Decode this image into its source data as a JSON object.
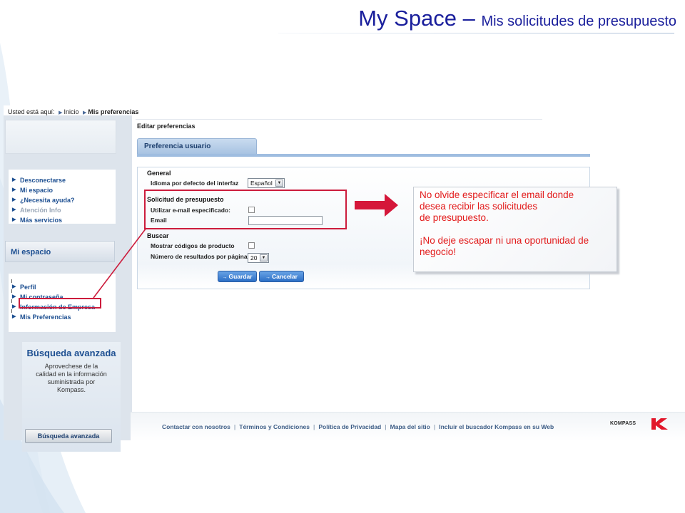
{
  "slide": {
    "title_main": "My Space",
    "title_dash": " – ",
    "title_sub": "Mis solicitudes de presupuesto"
  },
  "breadcrumb": {
    "prefix": "Usted está aquí:",
    "items": [
      "Inicio",
      "Mis preferencias"
    ]
  },
  "sidebar": {
    "links": [
      {
        "label": "Desconectarse"
      },
      {
        "label": "Mi espacio"
      },
      {
        "label": "¿Necesita ayuda?"
      },
      {
        "label": "Atención Info"
      },
      {
        "label": "Más servicios"
      }
    ],
    "section_title": "Mi espacio",
    "myspace_links": [
      {
        "label": "Perfil"
      },
      {
        "label": "Mi contraseña"
      },
      {
        "label": "Información de Empresa"
      },
      {
        "label": "Mis Preferencias"
      }
    ],
    "advanced": {
      "title": "Búsqueda avanzada",
      "text_lines": [
        "Aprovechese de la",
        "calidad en la información",
        "suministrada por",
        "Kompass."
      ],
      "button": "Búsqueda avanzada"
    }
  },
  "content": {
    "title": "Editar preferencias",
    "tab": "Preferencia usuario",
    "general": {
      "title": "General",
      "language_label": "Idioma por defecto del interfaz",
      "language_value": "Español"
    },
    "quote": {
      "title": "Solicitud de presupuesto",
      "use_email_label": "Utilizar e-mail especificado:",
      "use_email_checked": false,
      "email_label": "Email",
      "email_value": ""
    },
    "search": {
      "title": "Buscar",
      "show_codes_label": "Mostrar códigos de producto",
      "show_codes_checked": false,
      "results_label": "Número de resultados por página",
      "results_value": "20"
    },
    "save_button": "Guardar",
    "cancel_button": "Cancelar"
  },
  "footer": {
    "links": [
      "Contactar con nosotros",
      "Términos y Condiciones",
      "Política de Privacidad",
      "Mapa del sitio",
      "Incluir el buscador Kompass en su Web"
    ],
    "logo_text": "KOMPASS"
  },
  "note": {
    "line1": "No olvide especificar el email donde",
    "line2": "desea recibir las solicitudes",
    "line3": "de presupuesto.",
    "line4": "¡No deje escapar ni una oportunidad de",
    "line5": "negocio!"
  },
  "colors": {
    "title": "#1a1f9c",
    "highlight": "#cc1c3c",
    "note_text": "#e21b1b",
    "link_blue": "#1d4f91",
    "kompass_red": "#e2162a"
  }
}
